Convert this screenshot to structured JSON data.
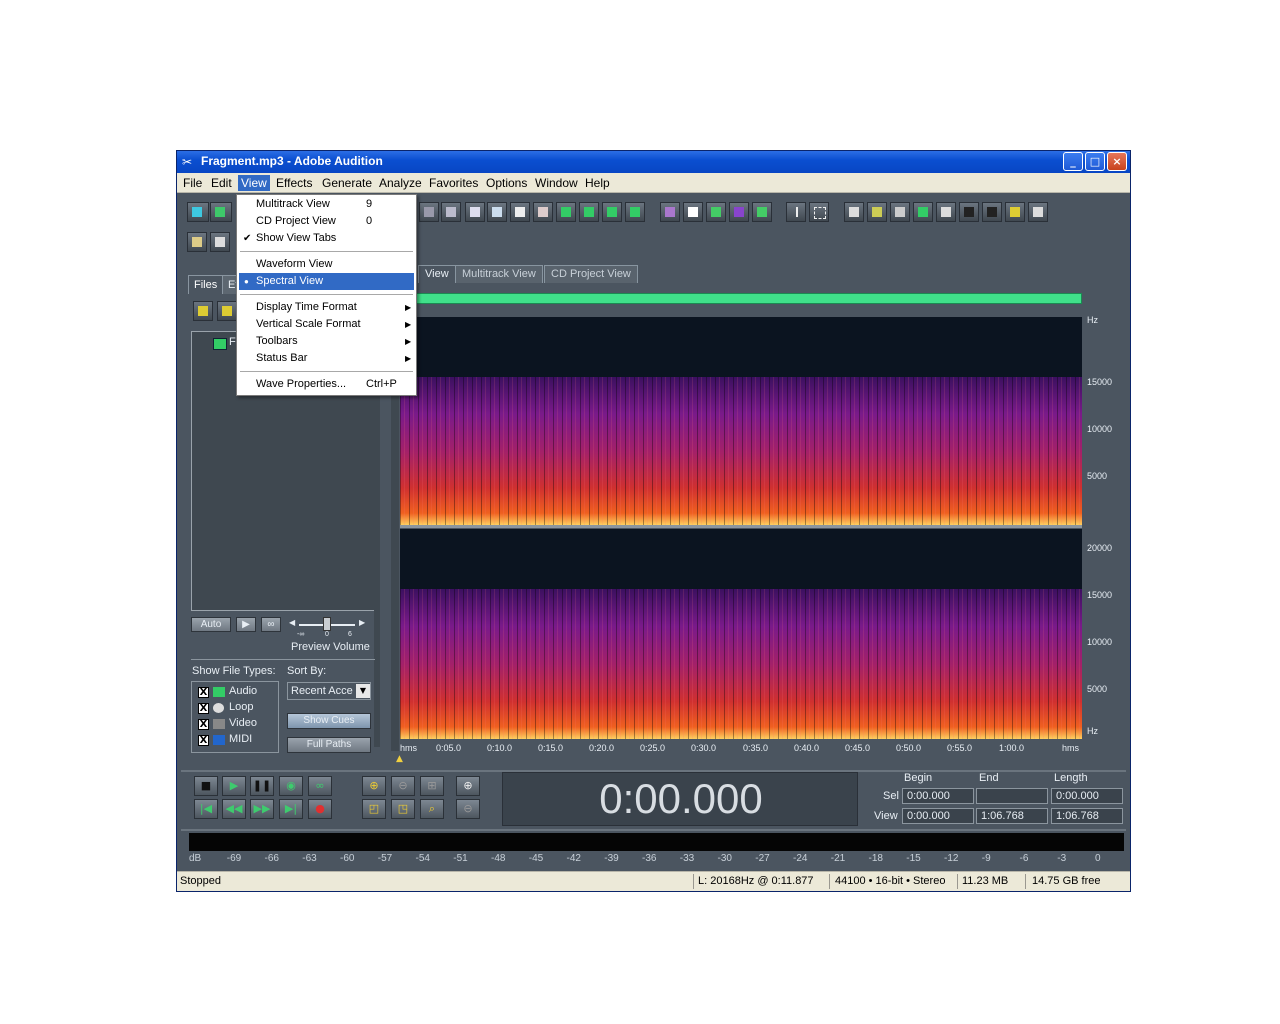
{
  "window": {
    "title": "Fragment.mp3 - Adobe Audition",
    "controls": [
      "_",
      "□",
      "×"
    ]
  },
  "menubar": [
    "File",
    "Edit",
    "View",
    "Effects",
    "Generate",
    "Analyze",
    "Favorites",
    "Options",
    "Window",
    "Help"
  ],
  "view_menu": {
    "items": [
      {
        "label": "Multitrack View",
        "shortcut": "9"
      },
      {
        "label": "CD Project View",
        "shortcut": "0"
      },
      {
        "label": "Show View Tabs",
        "check": "✔"
      },
      {
        "label": "Waveform View"
      },
      {
        "label": "Spectral View",
        "bullet": "●"
      },
      {
        "label": "Display Time Format",
        "arrow": "▶"
      },
      {
        "label": "Vertical Scale Format",
        "arrow": "▶"
      },
      {
        "label": "Toolbars",
        "arrow": "▶"
      },
      {
        "label": "Status Bar",
        "arrow": "▶"
      },
      {
        "label": "Wave Properties...",
        "shortcut": "Ctrl+P"
      }
    ]
  },
  "left_panel": {
    "tabs": [
      "Files",
      "Ef"
    ],
    "file_item": "F",
    "auto_label": "Auto",
    "preview_volume": "Preview Volume",
    "slider_marks": [
      "-∞",
      "0",
      "6"
    ],
    "show_file_types_label": "Show File Types:",
    "sort_by_label": "Sort By:",
    "sort_value": "Recent Acce",
    "file_types": [
      "Audio",
      "Loop",
      "Video",
      "MIDI"
    ],
    "show_cues": "Show Cues",
    "full_paths": "Full Paths"
  },
  "view_tabs": [
    "View",
    "Multitrack View",
    "CD Project View"
  ],
  "spectral": {
    "hz_top": [
      "Hz",
      "15000",
      "10000",
      "5000"
    ],
    "hz_bottom": [
      "20000",
      "15000",
      "10000",
      "5000",
      "Hz"
    ],
    "time_ticks": [
      "hms",
      "0:05.0",
      "0:10.0",
      "0:15.0",
      "0:20.0",
      "0:25.0",
      "0:30.0",
      "0:35.0",
      "0:40.0",
      "0:45.0",
      "0:50.0",
      "0:55.0",
      "1:00.0",
      "hms"
    ]
  },
  "transport": {
    "time": "0:00.000",
    "headers": [
      "Begin",
      "End",
      "Length"
    ],
    "sel_label": "Sel",
    "view_label": "View",
    "sel": [
      "0:00.000",
      "",
      "0:00.000"
    ],
    "view": [
      "0:00.000",
      "1:06.768",
      "1:06.768"
    ]
  },
  "level_meter": [
    "dB",
    "-69",
    "-66",
    "-63",
    "-60",
    "-57",
    "-54",
    "-51",
    "-48",
    "-45",
    "-42",
    "-39",
    "-36",
    "-33",
    "-30",
    "-27",
    "-24",
    "-21",
    "-18",
    "-15",
    "-12",
    "-9",
    "-6",
    "-3",
    "0"
  ],
  "status": {
    "state": "Stopped",
    "cursor": "L: 20168Hz @   0:11.877",
    "format": "44100 • 16-bit • Stereo",
    "size": "11.23 MB",
    "free": "14.75 GB free"
  },
  "colors": {
    "title_blue": "#0b4fd1",
    "panel_gray": "#4b5560",
    "overview_green": "#40e08a",
    "menu_highlight": "#316ac5",
    "spectrum_hot": "#e8302a"
  }
}
